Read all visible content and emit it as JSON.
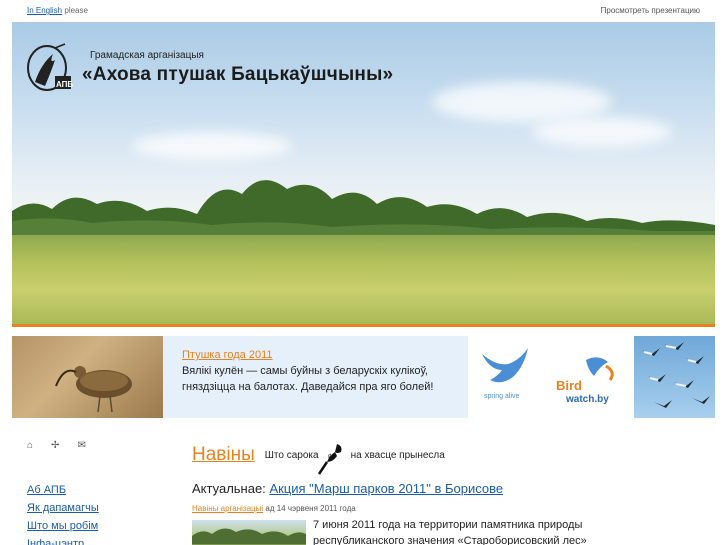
{
  "topbar": {
    "english_link": "In English",
    "please": " please",
    "presentation": "Просмотреть презентацию"
  },
  "header": {
    "org_subtitle": "Грамадская арганізацыя",
    "org_title": "«Ахова птушак Бацькаўшчыны»",
    "logo_icon": "apb-bird-logo"
  },
  "banner": {
    "bird_of_year_link": "Птушка года 2011",
    "bird_of_year_text": "Вялікі кулён — самы буйны з беларускіх кулікоў, гняздзіцца на балотах. Даведайся пра яго болей!",
    "spring_alive_label": "spring alive",
    "birdwatch_line1": "Bird",
    "birdwatch_line2": "watch.by"
  },
  "sidebar": {
    "icons": [
      "home-icon",
      "sitemap-icon",
      "mail-icon"
    ],
    "items": [
      {
        "label": "Аб АПБ"
      },
      {
        "label": "Як дапамагчы"
      },
      {
        "label": "Што мы робім"
      },
      {
        "label": "Інфа-цэнтр"
      }
    ]
  },
  "news": {
    "title": "Навіны",
    "slogan_part1": "Што сарока",
    "slogan_part2": "на хвасце прынесла",
    "actual_label": "Актуальнае:",
    "actual_link": "Акция \"Марш парков 2011\" в Борисове",
    "meta_category": "Навіны арганізацыі",
    "meta_date": " ад 14 чэрвеня 2011 года",
    "lead": "7 июня 2011 года на территории памятника природы республиканского значения «Староборисовский лес»"
  },
  "colors": {
    "accent": "#e8821e",
    "link": "#1a5ea8",
    "banner_bg": "#e5f0fb"
  }
}
